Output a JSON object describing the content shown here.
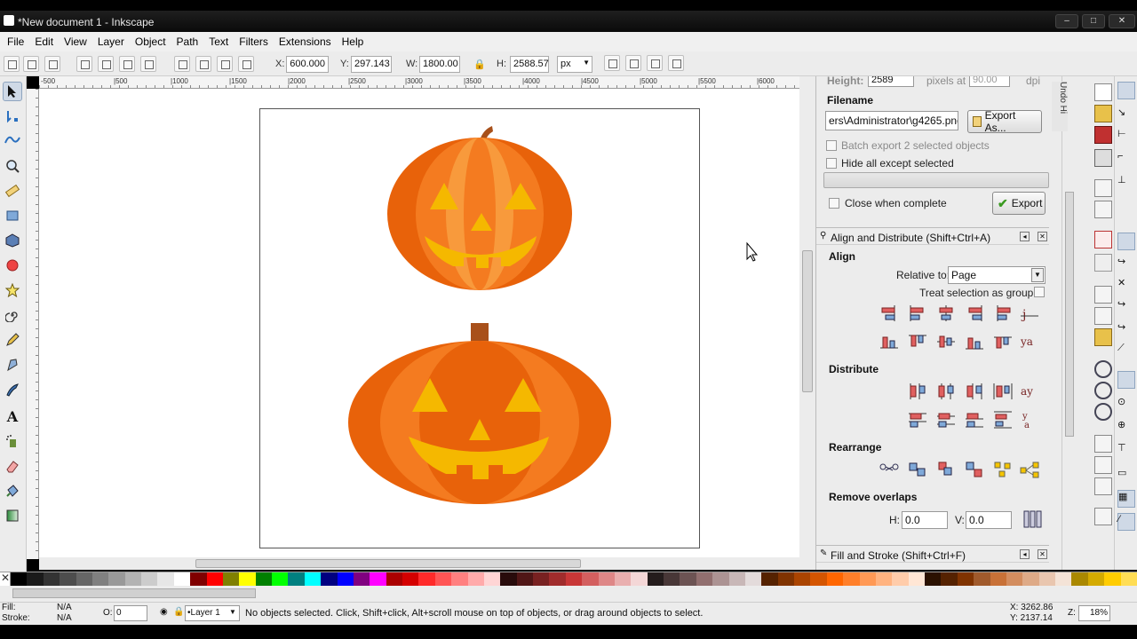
{
  "window": {
    "title": "*New document 1 - Inkscape",
    "controls": [
      "–",
      "□",
      "✕"
    ]
  },
  "menubar": [
    "File",
    "Edit",
    "View",
    "Layer",
    "Object",
    "Path",
    "Text",
    "Filters",
    "Extensions",
    "Help"
  ],
  "controls_bar": {
    "x_label": "X:",
    "x_value": "600.000",
    "y_label": "Y:",
    "y_value": "297.143",
    "w_label": "W:",
    "w_value": "1800.00",
    "h_label": "H:",
    "h_value": "2588.57",
    "unit": "px"
  },
  "rulers": {
    "horizontal_ticks": [
      "-500",
      "|500",
      "|1000",
      "|1500",
      "|2000",
      "|2500",
      "|3000",
      "|3500",
      "|4000",
      "|4500",
      "|5000",
      "|5500",
      "|6000"
    ]
  },
  "tools": [
    "selector-tool",
    "node-tool",
    "tweak-tool",
    "zoom-tool",
    "measure-tool",
    "rectangle-tool",
    "3d-box-tool",
    "ellipse-tool",
    "star-tool",
    "spiral-tool",
    "pencil-tool",
    "pen-tool",
    "calligraphy-tool",
    "text-tool",
    "spray-tool",
    "eraser-tool",
    "paint-bucket-tool",
    "gradient-tool"
  ],
  "export_panel": {
    "height_label": "Height:",
    "height_value": "2589",
    "dpi_label": "pixels at",
    "dpi_value": "90.00",
    "dpi_unit": "dpi",
    "filename_label": "Filename",
    "filename_value": "ers\\Administrator\\g4265.png",
    "export_as_label": "Export As...",
    "batch_label": "Batch export 2 selected objects",
    "hide_label": "Hide all except selected",
    "close_label": "Close when complete",
    "export_label": "Export"
  },
  "align_panel": {
    "title": "Align and Distribute (Shift+Ctrl+A)",
    "align_heading": "Align",
    "relative_label": "Relative to:",
    "relative_value": "Page",
    "treat_label": "Treat selection as group:",
    "distribute_heading": "Distribute",
    "rearrange_heading": "Rearrange",
    "remove_overlaps_heading": "Remove overlaps",
    "h_label": "H:",
    "h_value": "0.0",
    "v_label": "V:",
    "v_value": "0.0"
  },
  "fill_stroke_panel": {
    "title": "Fill and Stroke (Shift+Ctrl+F)"
  },
  "undo_tab": "Undo Hi",
  "status": {
    "fill_label": "Fill:",
    "fill_value": "N/A",
    "stroke_label": "Stroke:",
    "stroke_value": "N/A",
    "opacity_label": "O:",
    "opacity_value": "0",
    "layer": "•Layer 1",
    "message": "No objects selected. Click, Shift+click, Alt+scroll mouse on top of objects, or drag around objects to select.",
    "x_coord": "X: 3262.86",
    "y_coord": "Y: 2137.14",
    "zoom_label": "Z:",
    "zoom_value": "18%"
  },
  "colors": {
    "pumpkin_dark": "#e8620a",
    "pumpkin_mid": "#f47b20",
    "pumpkin_light": "#f89a3c",
    "face_yellow": "#f5b800",
    "stem": "#a8501a"
  },
  "palette": [
    "#000000",
    "#1a1a1a",
    "#333333",
    "#4d4d4d",
    "#666666",
    "#808080",
    "#999999",
    "#b3b3b3",
    "#cccccc",
    "#e6e6e6",
    "#ffffff",
    "#800000",
    "#ff0000",
    "#808000",
    "#ffff00",
    "#008000",
    "#00ff00",
    "#008080",
    "#00ffff",
    "#000080",
    "#0000ff",
    "#800080",
    "#ff00ff",
    "#aa0000",
    "#d40000",
    "#ff2a2a",
    "#ff5555",
    "#ff8080",
    "#ffaaaa",
    "#ffd5d5",
    "#280b0b",
    "#501616",
    "#782121",
    "#a02c2c",
    "#c83737",
    "#d35f5f",
    "#de8787",
    "#e9afaf",
    "#f4d7d7",
    "#241c1c",
    "#483737",
    "#6c5353",
    "#916f6f",
    "#ac9393",
    "#c8b7b7",
    "#e3dbdb",
    "#552200",
    "#803300",
    "#aa4400",
    "#d45500",
    "#ff6600",
    "#ff7f2a",
    "#ff9955",
    "#ffb380",
    "#ffccaa",
    "#ffe6d5",
    "#2b1100",
    "#552200",
    "#803300",
    "#a05a2c",
    "#c87137",
    "#d38d5f",
    "#deaa87",
    "#e9c6af",
    "#f4e3d7",
    "#aa8800",
    "#d4aa00",
    "#ffcc00",
    "#ffdd55"
  ]
}
